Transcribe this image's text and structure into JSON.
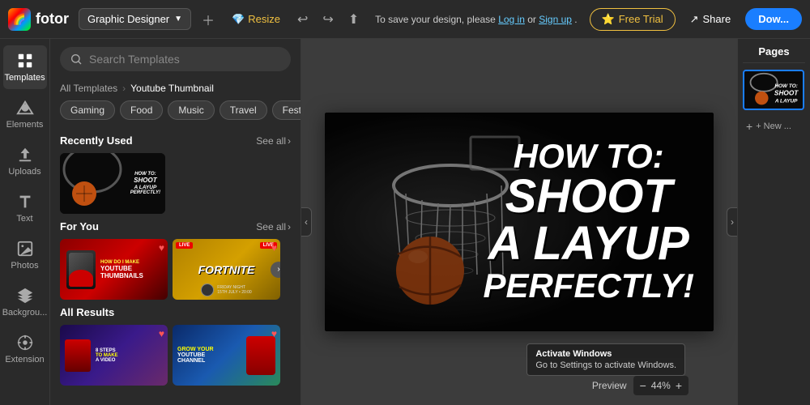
{
  "app": {
    "logo_text": "fotor",
    "logo_emoji": "🌈"
  },
  "topbar": {
    "designer_label": "Graphic Designer",
    "resize_label": "Resize",
    "save_message": "To save your design, please",
    "save_login": "Log in",
    "save_or": "or",
    "save_signup": "Sign up",
    "save_period": ".",
    "free_trial_label": "Free Trial",
    "share_label": "Share",
    "download_label": "Dow..."
  },
  "sidebar": {
    "items": [
      {
        "id": "templates",
        "label": "Templates",
        "icon": "grid"
      },
      {
        "id": "elements",
        "label": "Elements",
        "icon": "shapes"
      },
      {
        "id": "uploads",
        "label": "Uploads",
        "icon": "upload"
      },
      {
        "id": "text",
        "label": "Text",
        "icon": "text"
      },
      {
        "id": "photos",
        "label": "Photos",
        "icon": "photo"
      },
      {
        "id": "background",
        "label": "Backgrou...",
        "icon": "layers"
      },
      {
        "id": "extension",
        "label": "Extension",
        "icon": "extension"
      }
    ],
    "active": "templates"
  },
  "templates_panel": {
    "search_placeholder": "Search Templates",
    "breadcrumb_root": "All Templates",
    "breadcrumb_current": "Youtube Thumbnail",
    "filter_chips": [
      {
        "label": "Gaming",
        "active": false
      },
      {
        "label": "Food",
        "active": false
      },
      {
        "label": "Music",
        "active": false
      },
      {
        "label": "Travel",
        "active": false
      },
      {
        "label": "Festi...",
        "active": false
      }
    ],
    "recently_used_title": "Recently Used",
    "recently_used_see_all": "See all",
    "recently_used_items": [
      {
        "id": "bball",
        "text_lines": [
          "HOW TO:",
          "SHOOT",
          "A LAYUP",
          "PERFECTLY!"
        ]
      }
    ],
    "for_you_title": "For You",
    "for_you_see_all": "See all",
    "for_you_items": [
      {
        "id": "yt1",
        "bg": "red",
        "text": "HOW DO I MAKE YOUTUBE THUMBNAILS"
      },
      {
        "id": "yt2",
        "bg": "gold",
        "text": "FORTNITE"
      }
    ],
    "all_results_title": "All Results",
    "all_results_items": [
      {
        "id": "ar1",
        "text": "8 STEPS TO MAKE A VIDEO"
      },
      {
        "id": "ar2",
        "text": "GROW YOUR YOUTUBE CHANNEL"
      }
    ]
  },
  "canvas": {
    "main_text": {
      "line1": "HOW TO:",
      "line2": "SHOOT",
      "line3": "A LAYUP",
      "line4": "PERFECTLY!"
    },
    "zoom_value": "44%",
    "preview_label": "Preview"
  },
  "pages_panel": {
    "title": "Pages",
    "add_page_label": "+ New ..."
  },
  "activate_notice": {
    "title": "Activate Windows",
    "body": "Go to Settings to activate Windows."
  }
}
